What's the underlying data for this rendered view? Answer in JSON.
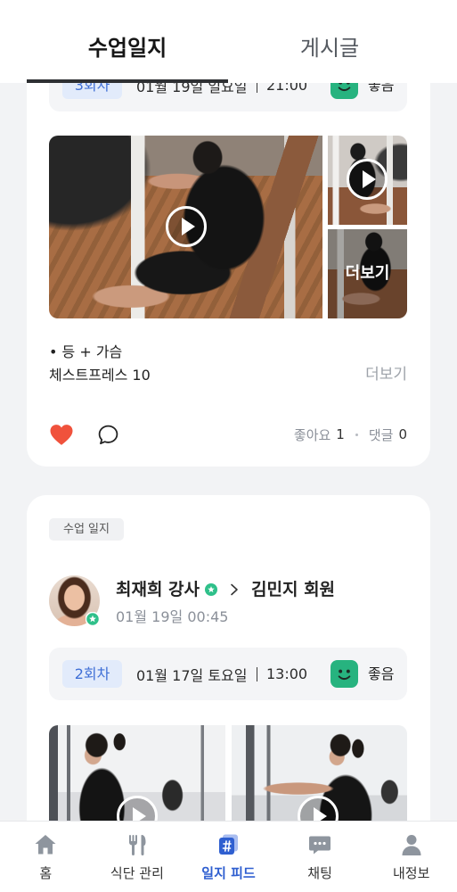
{
  "header": {
    "tabs": [
      {
        "label": "수업일지",
        "active": true
      },
      {
        "label": "게시글",
        "active": false
      }
    ]
  },
  "colors": {
    "background": "#f2f3f5",
    "accent": "#2f5fd0",
    "badge_text": "#3f6fd6",
    "badge_bg": "#e2ebfb",
    "mood_green": "#27b37f",
    "like_red": "#f0523c",
    "verified_green": "#2fc08a"
  },
  "feed": [
    {
      "session": {
        "round": "3회차",
        "date": "01월 19일 일요일",
        "time": "21:00",
        "mood": "좋음",
        "mood_icon": "smile-face-icon"
      },
      "media": {
        "more_label": "더보기",
        "play_icon": "play-icon"
      },
      "body": {
        "lines": [
          "• 등 + 가슴",
          "체스트프레스 10"
        ],
        "more_label": "더보기"
      },
      "actions": {
        "liked": true,
        "like_icon": "heart-icon",
        "comment_icon": "comment-icon"
      },
      "stats": {
        "likes_label": "좋아요",
        "likes": "1",
        "comments_label": "댓글",
        "comments": "0"
      }
    },
    {
      "tag": "수업 일지",
      "author": {
        "name": "최재희 강사",
        "verified_icon": "verified-star-icon",
        "target": "김민지 회원",
        "timestamp": "01월 19일 00:45"
      },
      "session": {
        "round": "2회차",
        "date": "01월 17일 토요일",
        "time": "13:00",
        "mood": "좋음",
        "mood_icon": "smile-face-icon"
      }
    }
  ],
  "bottom_nav": {
    "items": [
      {
        "label": "홈",
        "icon": "home-icon",
        "active": false
      },
      {
        "label": "식단 관리",
        "icon": "fork-knife-icon",
        "active": false
      },
      {
        "label": "일지 피드",
        "icon": "hashtag-feed-icon",
        "active": true
      },
      {
        "label": "채팅",
        "icon": "chat-icon",
        "active": false
      },
      {
        "label": "내정보",
        "icon": "person-icon",
        "active": false
      }
    ]
  }
}
